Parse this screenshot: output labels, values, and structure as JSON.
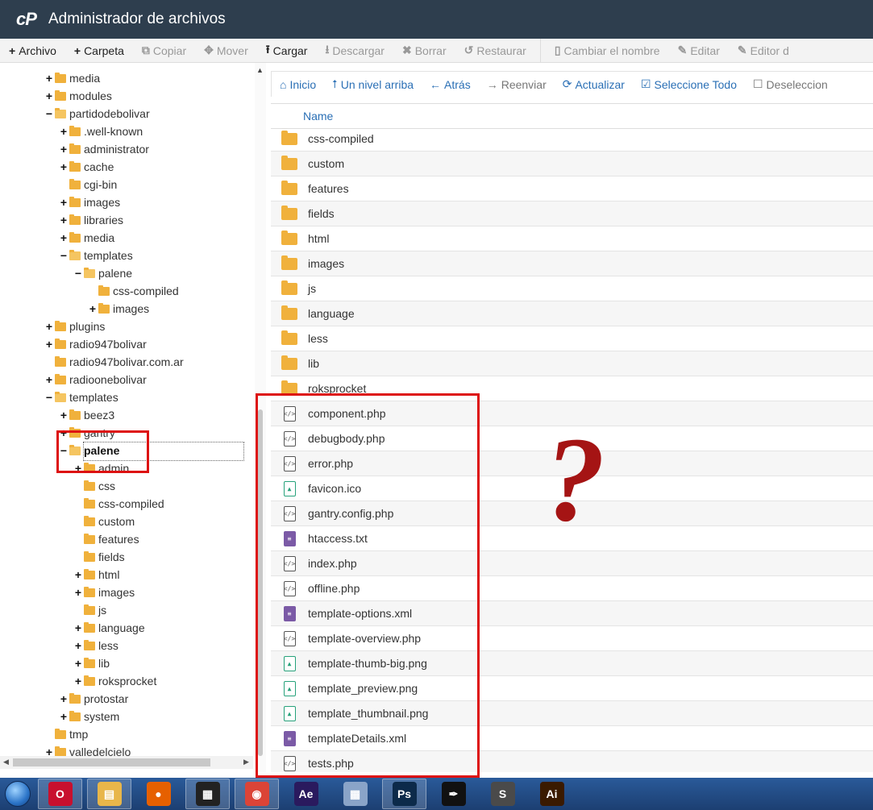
{
  "header": {
    "logo": "cP",
    "title": "Administrador de archivos"
  },
  "toolbar": {
    "items": [
      {
        "label": "Archivo",
        "icon": "+",
        "enabled": true
      },
      {
        "label": "Carpeta",
        "icon": "+",
        "enabled": true
      },
      {
        "label": "Copiar",
        "icon": "⧉",
        "enabled": false
      },
      {
        "label": "Mover",
        "icon": "✥",
        "enabled": false
      },
      {
        "label": "Cargar",
        "icon": "⭱",
        "enabled": true
      },
      {
        "label": "Descargar",
        "icon": "⭳",
        "enabled": false
      },
      {
        "label": "Borrar",
        "icon": "✖",
        "enabled": false
      },
      {
        "label": "Restaurar",
        "icon": "↺",
        "enabled": false
      },
      {
        "label": "Cambiar el nombre",
        "icon": "▯",
        "enabled": false
      },
      {
        "label": "Editar",
        "icon": "✎",
        "enabled": false
      },
      {
        "label": "Editor d",
        "icon": "✎",
        "enabled": false
      }
    ]
  },
  "tree": [
    {
      "name": "media",
      "level": 1,
      "toggle": "+"
    },
    {
      "name": "modules",
      "level": 1,
      "toggle": "+"
    },
    {
      "name": "partidodebolivar",
      "level": 1,
      "toggle": "−",
      "open": true
    },
    {
      "name": ".well-known",
      "level": 2,
      "toggle": "+"
    },
    {
      "name": "administrator",
      "level": 2,
      "toggle": "+"
    },
    {
      "name": "cache",
      "level": 2,
      "toggle": "+"
    },
    {
      "name": "cgi-bin",
      "level": 2,
      "toggle": ""
    },
    {
      "name": "images",
      "level": 2,
      "toggle": "+"
    },
    {
      "name": "libraries",
      "level": 2,
      "toggle": "+"
    },
    {
      "name": "media",
      "level": 2,
      "toggle": "+"
    },
    {
      "name": "templates",
      "level": 2,
      "toggle": "−",
      "open": true
    },
    {
      "name": "palene",
      "level": 3,
      "toggle": "−",
      "open": true
    },
    {
      "name": "css-compiled",
      "level": 4,
      "toggle": ""
    },
    {
      "name": "images",
      "level": 4,
      "toggle": "+"
    },
    {
      "name": "plugins",
      "level": 1,
      "toggle": "+"
    },
    {
      "name": "radio947bolivar",
      "level": 1,
      "toggle": "+"
    },
    {
      "name": "radio947bolivar.com.ar",
      "level": 1,
      "toggle": ""
    },
    {
      "name": "radioonebolivar",
      "level": 1,
      "toggle": "+"
    },
    {
      "name": "templates",
      "level": 1,
      "toggle": "−",
      "open": true
    },
    {
      "name": "beez3",
      "level": 2,
      "toggle": "+"
    },
    {
      "name": "gantry",
      "level": 2,
      "toggle": "+"
    },
    {
      "name": "palene",
      "level": 2,
      "toggle": "−",
      "open": true,
      "selected": true
    },
    {
      "name": "admin",
      "level": 3,
      "toggle": "+"
    },
    {
      "name": "css",
      "level": 3,
      "toggle": ""
    },
    {
      "name": "css-compiled",
      "level": 3,
      "toggle": ""
    },
    {
      "name": "custom",
      "level": 3,
      "toggle": ""
    },
    {
      "name": "features",
      "level": 3,
      "toggle": ""
    },
    {
      "name": "fields",
      "level": 3,
      "toggle": ""
    },
    {
      "name": "html",
      "level": 3,
      "toggle": "+"
    },
    {
      "name": "images",
      "level": 3,
      "toggle": "+"
    },
    {
      "name": "js",
      "level": 3,
      "toggle": ""
    },
    {
      "name": "language",
      "level": 3,
      "toggle": "+"
    },
    {
      "name": "less",
      "level": 3,
      "toggle": "+"
    },
    {
      "name": "lib",
      "level": 3,
      "toggle": "+"
    },
    {
      "name": "roksprocket",
      "level": 3,
      "toggle": "+"
    },
    {
      "name": "protostar",
      "level": 2,
      "toggle": "+"
    },
    {
      "name": "system",
      "level": 2,
      "toggle": "+"
    },
    {
      "name": "tmp",
      "level": 1,
      "toggle": ""
    },
    {
      "name": "valledelcielo",
      "level": 1,
      "toggle": "+"
    }
  ],
  "nav": [
    {
      "label": "Inicio",
      "icon": "⌂",
      "enabled": true
    },
    {
      "label": "Un nivel arriba",
      "icon": "⭡",
      "enabled": true
    },
    {
      "label": "Atrás",
      "icon": "←",
      "enabled": true
    },
    {
      "label": "Reenviar",
      "icon": "→",
      "enabled": false
    },
    {
      "label": "Actualizar",
      "icon": "⟳",
      "enabled": true
    },
    {
      "label": "Seleccione Todo",
      "icon": "☑",
      "enabled": true
    },
    {
      "label": "Deseleccion",
      "icon": "☐",
      "enabled": false
    }
  ],
  "columns": {
    "name": "Name"
  },
  "files": [
    {
      "name": "css-compiled",
      "kind": "folder"
    },
    {
      "name": "custom",
      "kind": "folder"
    },
    {
      "name": "features",
      "kind": "folder"
    },
    {
      "name": "fields",
      "kind": "folder"
    },
    {
      "name": "html",
      "kind": "folder"
    },
    {
      "name": "images",
      "kind": "folder"
    },
    {
      "name": "js",
      "kind": "folder"
    },
    {
      "name": "language",
      "kind": "folder"
    },
    {
      "name": "less",
      "kind": "folder"
    },
    {
      "name": "lib",
      "kind": "folder"
    },
    {
      "name": "roksprocket",
      "kind": "folder"
    },
    {
      "name": "component.php",
      "kind": "code"
    },
    {
      "name": "debugbody.php",
      "kind": "code"
    },
    {
      "name": "error.php",
      "kind": "code"
    },
    {
      "name": "favicon.ico",
      "kind": "image"
    },
    {
      "name": "gantry.config.php",
      "kind": "code"
    },
    {
      "name": "htaccess.txt",
      "kind": "text"
    },
    {
      "name": "index.php",
      "kind": "code"
    },
    {
      "name": "offline.php",
      "kind": "code"
    },
    {
      "name": "template-options.xml",
      "kind": "text"
    },
    {
      "name": "template-overview.php",
      "kind": "code"
    },
    {
      "name": "template-thumb-big.png",
      "kind": "image"
    },
    {
      "name": "template_preview.png",
      "kind": "image"
    },
    {
      "name": "template_thumbnail.png",
      "kind": "image"
    },
    {
      "name": "templateDetails.xml",
      "kind": "text"
    },
    {
      "name": "tests.php",
      "kind": "code"
    }
  ],
  "annotation": {
    "text": "?"
  },
  "taskbar": [
    {
      "name": "opera",
      "glyph": "O",
      "color": "#c8102e",
      "active": true
    },
    {
      "name": "explorer",
      "glyph": "▤",
      "color": "#e8b64a",
      "active": true
    },
    {
      "name": "firefox",
      "glyph": "●",
      "color": "#e66000",
      "active": false
    },
    {
      "name": "video-editor",
      "glyph": "▦",
      "color": "#222222",
      "active": true
    },
    {
      "name": "chrome",
      "glyph": "◉",
      "color": "#db4437",
      "active": true
    },
    {
      "name": "after-effects",
      "glyph": "Ae",
      "color": "#2a1a5e",
      "active": false
    },
    {
      "name": "calculator",
      "glyph": "▦",
      "color": "#8aa4c8",
      "active": false
    },
    {
      "name": "photoshop",
      "glyph": "Ps",
      "color": "#0c2a4a",
      "active": true
    },
    {
      "name": "inkscape",
      "glyph": "✒",
      "color": "#111111",
      "active": false
    },
    {
      "name": "sublime-text",
      "glyph": "S",
      "color": "#4a4a4a",
      "active": false
    },
    {
      "name": "illustrator",
      "glyph": "Ai",
      "color": "#3a1a00",
      "active": false
    }
  ]
}
